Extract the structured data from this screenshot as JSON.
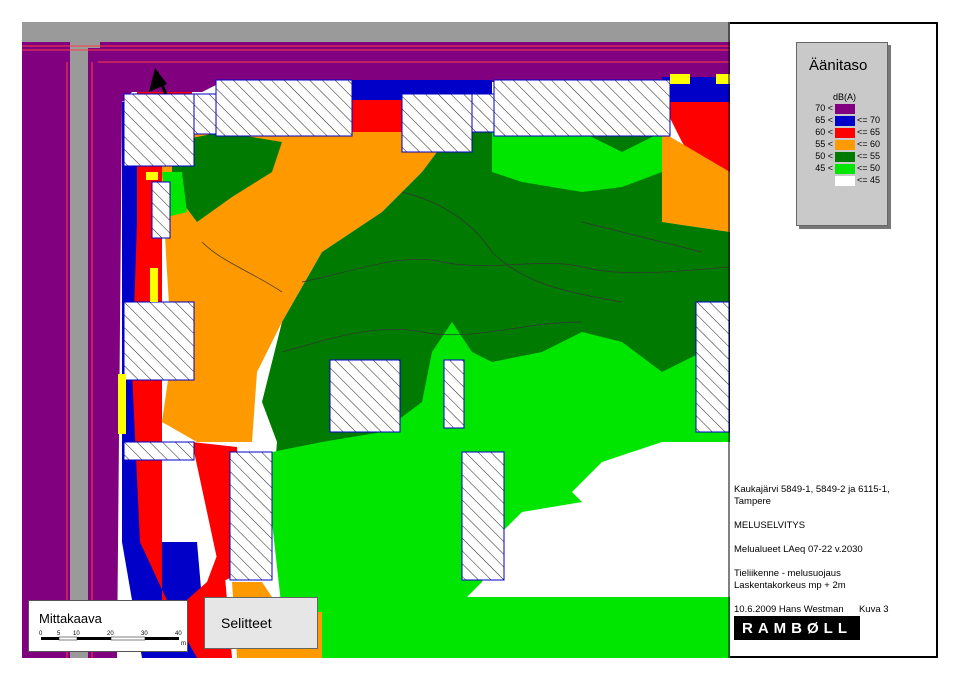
{
  "legend": {
    "title": "Äänitaso",
    "unit": "dB(A)",
    "rows": [
      {
        "low": "70 <",
        "high": "",
        "color": "#800080"
      },
      {
        "low": "65 <",
        "high": "<= 70",
        "color": "#0000c8"
      },
      {
        "low": "60 <",
        "high": "<= 65",
        "color": "#ff0000"
      },
      {
        "low": "55 <",
        "high": "<= 60",
        "color": "#ff9900"
      },
      {
        "low": "50 <",
        "high": "<= 55",
        "color": "#007a00"
      },
      {
        "low": "45 <",
        "high": "<= 50",
        "color": "#00e600"
      },
      {
        "low": "",
        "high": "<= 45",
        "color": "#ffffff"
      }
    ]
  },
  "info": {
    "project_line1": "Kaukajärvi 5849-1, 5849-2 ja 6115-1,",
    "project_line2": "Tampere",
    "report_type": "MELUSELVITYS",
    "zones": "Melualueet LAeq 07-22 v.2030",
    "traffic": "Tieliikenne - melusuojaus",
    "height": "Laskentakorkeus mp + 2m",
    "date_author": "10.6.2009  Hans Westman",
    "figure": "Kuva 3"
  },
  "logo": "RAMBØLL",
  "scale": {
    "title": "Mittakaava",
    "ticks": [
      "0",
      "5",
      "10",
      "20",
      "30",
      "40"
    ],
    "unit": "m"
  },
  "selitteet": "Selitteet",
  "north_label": "N",
  "colors": {
    "purple": "#800080",
    "blue": "#0000c8",
    "red": "#ff0000",
    "orange": "#ff9900",
    "darkgreen": "#007a00",
    "lightgreen": "#00e600",
    "road": "#9a9a9a",
    "barrier": "#ffff00"
  }
}
